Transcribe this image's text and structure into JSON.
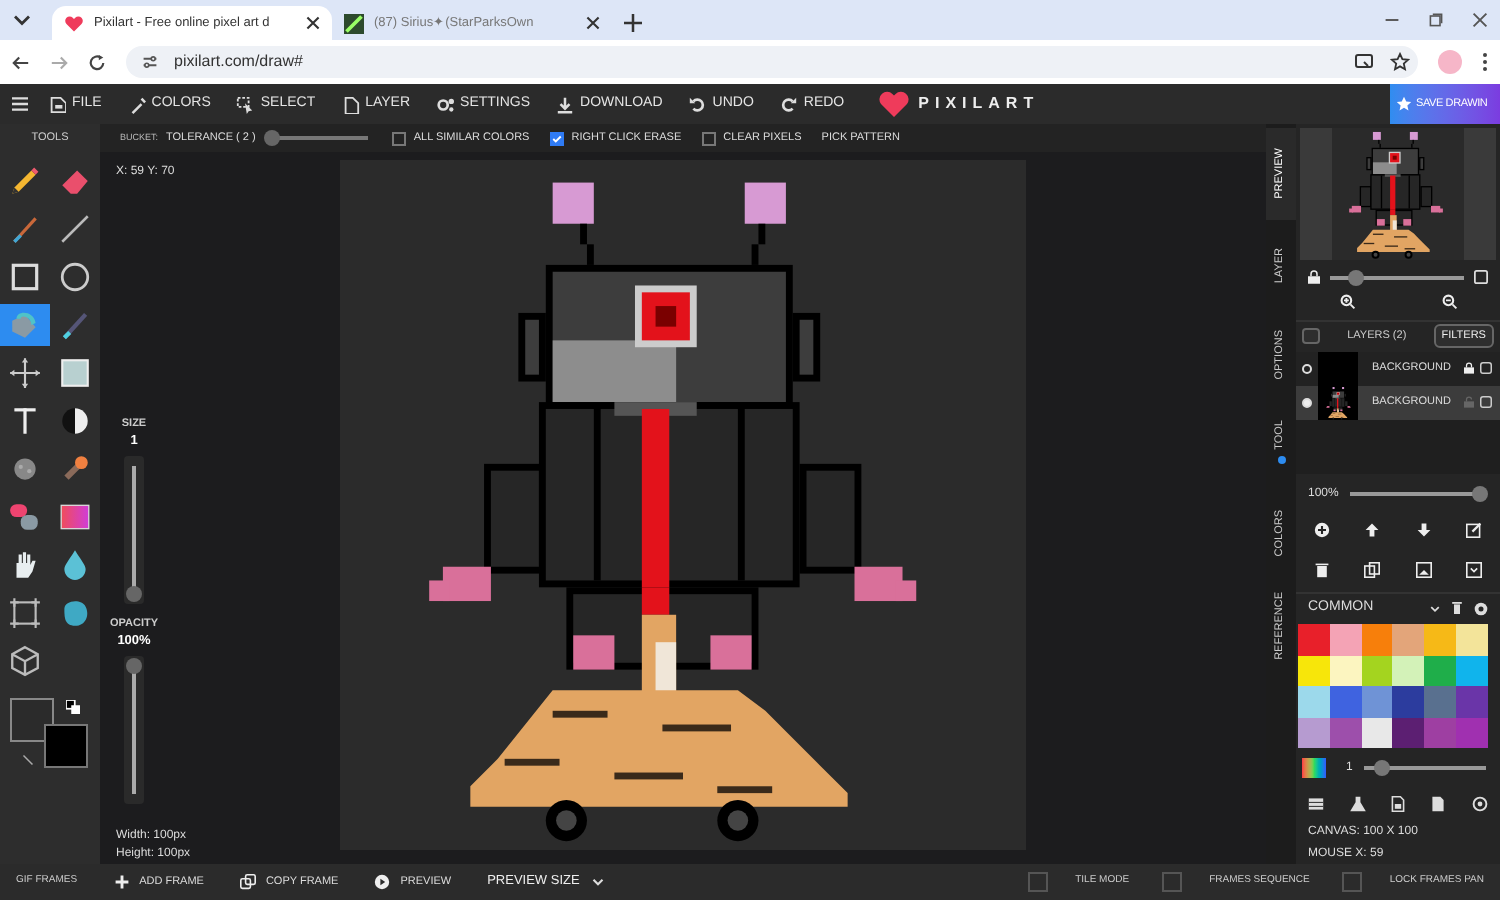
{
  "browser": {
    "tabs": [
      {
        "title": "Pixilart - Free online pixel art d",
        "selected": true
      },
      {
        "title": "(87) Sirius✦(StarParksOwn",
        "selected": false
      }
    ],
    "url": "pixilart.com/draw#"
  },
  "menu": {
    "items": [
      "FILE",
      "COLORS",
      "SELECT",
      "LAYER",
      "SETTINGS",
      "DOWNLOAD",
      "UNDO",
      "REDO"
    ],
    "logo": "PIXILART",
    "save_button": "SAVE DRAWIN"
  },
  "tool_options": {
    "tools_label": "TOOLS",
    "tool": "BUCKET:",
    "tolerance": "TOLERANCE ( 2 )",
    "level": 0.05,
    "checkboxes": [
      {
        "label": "ALL SIMILAR COLORS",
        "checked": false
      },
      {
        "label": "RIGHT CLICK ERASE",
        "checked": true
      },
      {
        "label": "CLEAR PIXELS",
        "checked": false
      }
    ],
    "pick_pattern": "PICK PATTERN"
  },
  "tools": [
    {
      "kind": "pencil",
      "selected": false
    },
    {
      "kind": "eraser",
      "selected": false
    },
    {
      "kind": "brush",
      "selected": false
    },
    {
      "kind": "line",
      "selected": false
    },
    {
      "kind": "rectangle",
      "selected": false
    },
    {
      "kind": "ellipse",
      "selected": false
    },
    {
      "kind": "bucket",
      "selected": true
    },
    {
      "kind": "pen",
      "selected": false
    },
    {
      "kind": "move",
      "selected": false
    },
    {
      "kind": "square",
      "selected": false
    },
    {
      "kind": "text",
      "selected": false
    },
    {
      "kind": "contrast",
      "selected": false
    },
    {
      "kind": "spray",
      "selected": false
    },
    {
      "kind": "stamp",
      "selected": false
    },
    {
      "kind": "mixer",
      "selected": false
    },
    {
      "kind": "gradient",
      "selected": false
    },
    {
      "kind": "hand",
      "selected": false
    },
    {
      "kind": "drop",
      "selected": false
    },
    {
      "kind": "crop",
      "selected": false
    },
    {
      "kind": "blob",
      "selected": false
    },
    {
      "kind": "cube",
      "selected": false
    }
  ],
  "workspace": {
    "coordinates": "X: 59 Y: 70",
    "size": {
      "label": "SIZE",
      "value": "1",
      "level": 0
    },
    "opacity": {
      "label": "OPACITY",
      "value": "100%",
      "level": 1
    },
    "width": "Width: 100px",
    "height": "Height: 100px"
  },
  "side_tabs": [
    {
      "label": "PREVIEW",
      "selected": true,
      "dot": false
    },
    {
      "label": "LAYER",
      "selected": false,
      "dot": false
    },
    {
      "label": "OPTIONS",
      "selected": false,
      "dot": false
    },
    {
      "label": "TOOL",
      "selected": false,
      "dot": true
    },
    {
      "label": "COLORS",
      "selected": false,
      "dot": false
    },
    {
      "label": "REFERENCE",
      "selected": false,
      "dot": false
    }
  ],
  "preview": {
    "zoom": {
      "level": 0.2
    }
  },
  "layers": {
    "title": "LAYERS (2)",
    "filters": "FILTERS",
    "items": [
      {
        "name": "BACKGROUND",
        "selected": false,
        "locked": true
      },
      {
        "name": "BACKGROUND",
        "selected": true,
        "locked": false
      }
    ],
    "opacity": {
      "value": "100%",
      "level": 1
    }
  },
  "palette": {
    "name": "COMMON",
    "colors": [
      {
        "color": "#e8202a"
      },
      {
        "color": "#f4a3b5"
      },
      {
        "color": "#f77f0b"
      },
      {
        "color": "#e3a57a"
      },
      {
        "color": "#f6b917"
      },
      {
        "color": "#f3e49a"
      },
      {
        "color": "#f7e60a"
      },
      {
        "color": "#fcf5c0"
      },
      {
        "color": "#a4d41f"
      },
      {
        "color": "#d3f2b8"
      },
      {
        "color": "#1fae4a"
      },
      {
        "color": "#10b4ec"
      },
      {
        "color": "#9cd9eb"
      },
      {
        "color": "#3f63e0"
      },
      {
        "color": "#6f93d6"
      },
      {
        "color": "#2c3c9e"
      },
      {
        "color": "#59708f"
      },
      {
        "color": "#6a35a8"
      },
      {
        "color": "#b69bd0"
      },
      {
        "color": "#9d4fab"
      },
      {
        "color": "#e8e8e8"
      },
      {
        "color": "#5c1f72"
      },
      {
        "color": "#9e3fa2"
      },
      {
        "color": "#a030b0"
      }
    ],
    "brush": {
      "value": "1",
      "level": 0.15
    }
  },
  "canvas_info": [
    "CANVAS: 100 X 100",
    "MOUSE X: 59"
  ],
  "bottom_bar": {
    "title": "GIF FRAMES",
    "actions": [
      "ADD FRAME",
      "COPY FRAME",
      "PREVIEW"
    ],
    "preview_size": "PREVIEW SIZE",
    "toggles": [
      {
        "label": "TILE MODE",
        "checked": false
      },
      {
        "label": "FRAMES SEQUENCE",
        "checked": false
      },
      {
        "label": "LOCK FRAMES PAN",
        "checked": false
      }
    ]
  }
}
